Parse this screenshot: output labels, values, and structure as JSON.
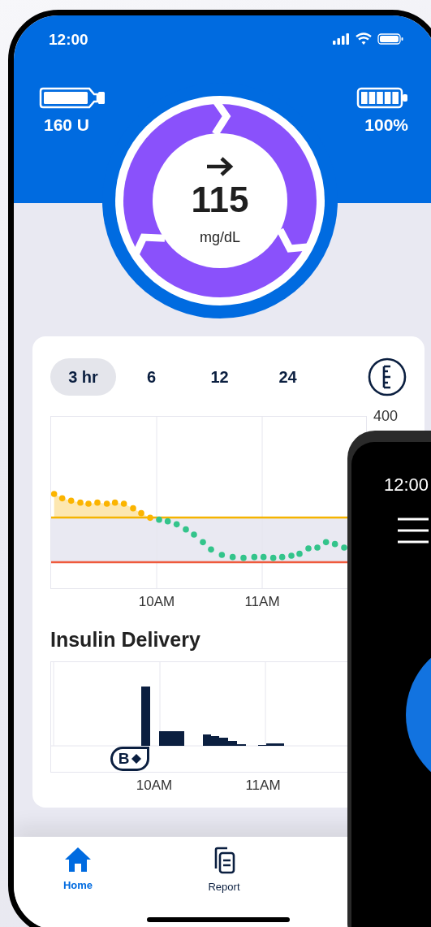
{
  "status_bar": {
    "time": "12:00"
  },
  "header": {
    "reservoir": "160 U",
    "battery": "100%"
  },
  "glucose": {
    "value": "115",
    "unit": "mg/dL"
  },
  "range_tabs": [
    {
      "label": "3 hr",
      "selected": true
    },
    {
      "label": "6",
      "selected": false
    },
    {
      "label": "12",
      "selected": false
    },
    {
      "label": "24",
      "selected": false
    }
  ],
  "glucose_chart": {
    "y_label": "400",
    "x_labels": [
      "10AM",
      "11AM"
    ]
  },
  "insulin_delivery": {
    "title": "Insulin Delivery",
    "bolus_badge": "B",
    "x_labels": [
      "10AM",
      "11AM"
    ]
  },
  "nav": [
    {
      "kind": "home",
      "label": "Home",
      "selected": true
    },
    {
      "kind": "report",
      "label": "Report",
      "selected": false
    }
  ],
  "second_phone": {
    "time": "12:00"
  }
}
